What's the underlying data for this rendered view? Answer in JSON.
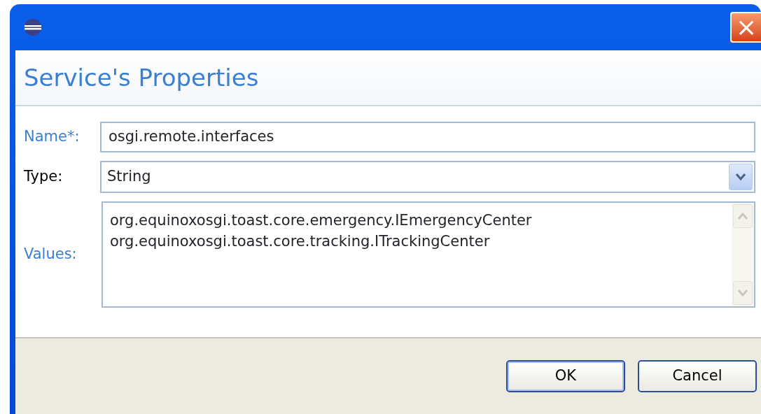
{
  "window": {
    "title_bar": {
      "close": "×"
    },
    "heading": "Service's Properties"
  },
  "fields": [
    {
      "kind": "text",
      "label": "Name*:",
      "highlighted": true,
      "value": "osgi.remote.interfaces"
    },
    {
      "kind": "select",
      "label": "Type:",
      "highlighted": false,
      "value": "String"
    },
    {
      "kind": "list",
      "label": "Values:",
      "highlighted": true,
      "values": [
        "org.equinoxosgi.toast.core.emergency.IEmergencyCenter",
        "org.equinoxosgi.toast.core.tracking.ITrackingCenter"
      ]
    }
  ],
  "buttons": [
    {
      "label": "OK",
      "default": true
    },
    {
      "label": "Cancel",
      "default": false
    }
  ]
}
